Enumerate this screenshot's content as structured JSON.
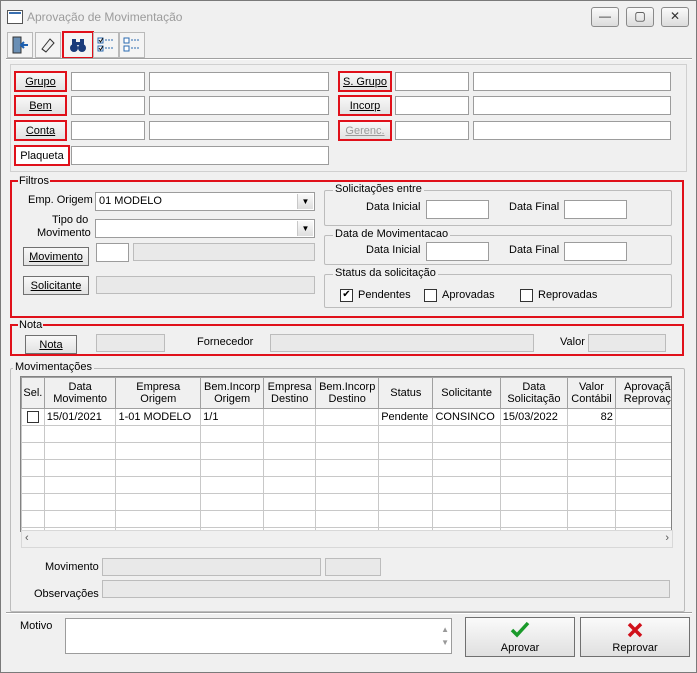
{
  "window": {
    "title": "Aprovação de Movimentação",
    "minimize": "—",
    "maximize": "▢",
    "close": "✕"
  },
  "toolbar": {
    "exit_icon": "exit-door-icon",
    "clear_icon": "eraser-icon",
    "search_icon": "binoculars-icon",
    "select_all_icon": "checklist-all-icon",
    "deselect_icon": "checklist-none-icon"
  },
  "top": {
    "grupo": "Grupo",
    "bem": "Bem",
    "conta": "Conta",
    "plaqueta": "Plaqueta",
    "s_grupo": "S. Grupo",
    "incorp": "Incorp",
    "gerenc": "Gerenc."
  },
  "filtros": {
    "title": "Filtros",
    "emp_origem_label": "Emp. Origem",
    "emp_origem_value": "01 MODELO",
    "tipo_mov_label1": "Tipo do",
    "tipo_mov_label2": "Movimento",
    "movimento_btn": "Movimento",
    "solicitante_btn": "Solicitante",
    "solicitacoes_title": "Solicitações entre",
    "data_mov_title": "Data de Movimentacao",
    "data_inicial": "Data Inicial",
    "data_final": "Data Final",
    "status_title": "Status da solicitação",
    "pendentes": "Pendentes",
    "aprovadas": "Aprovadas",
    "reprovadas": "Reprovadas"
  },
  "nota": {
    "title": "Nota",
    "nota_btn": "Nota",
    "fornecedor": "Fornecedor",
    "valor": "Valor"
  },
  "movs": {
    "title": "Movimentações",
    "headers": [
      "Sel.",
      "Data\nMovimento",
      "Empresa\nOrigem",
      "Bem.Incorp\nOrigem",
      "Empresa\nDestino",
      "Bem.Incorp\nDestino",
      "Status",
      "Solicitante",
      "Data\nSolicitação",
      "Valor\nContábil",
      "Aprovação /\nReprovação"
    ],
    "rows": [
      [
        "",
        "15/01/2021",
        "1-01 MODELO",
        "1/1",
        "",
        "",
        "Pendente",
        "CONSINCO",
        "15/03/2022",
        "82",
        ""
      ]
    ],
    "movimento_label": "Movimento",
    "observacoes_label": "Observações"
  },
  "bottom": {
    "motivo": "Motivo",
    "aprovar": "Aprovar",
    "reprovar": "Reprovar"
  },
  "colors": {
    "highlight": "#e0101a",
    "approve": "#1a9a2a",
    "reject": "#d0101a"
  }
}
